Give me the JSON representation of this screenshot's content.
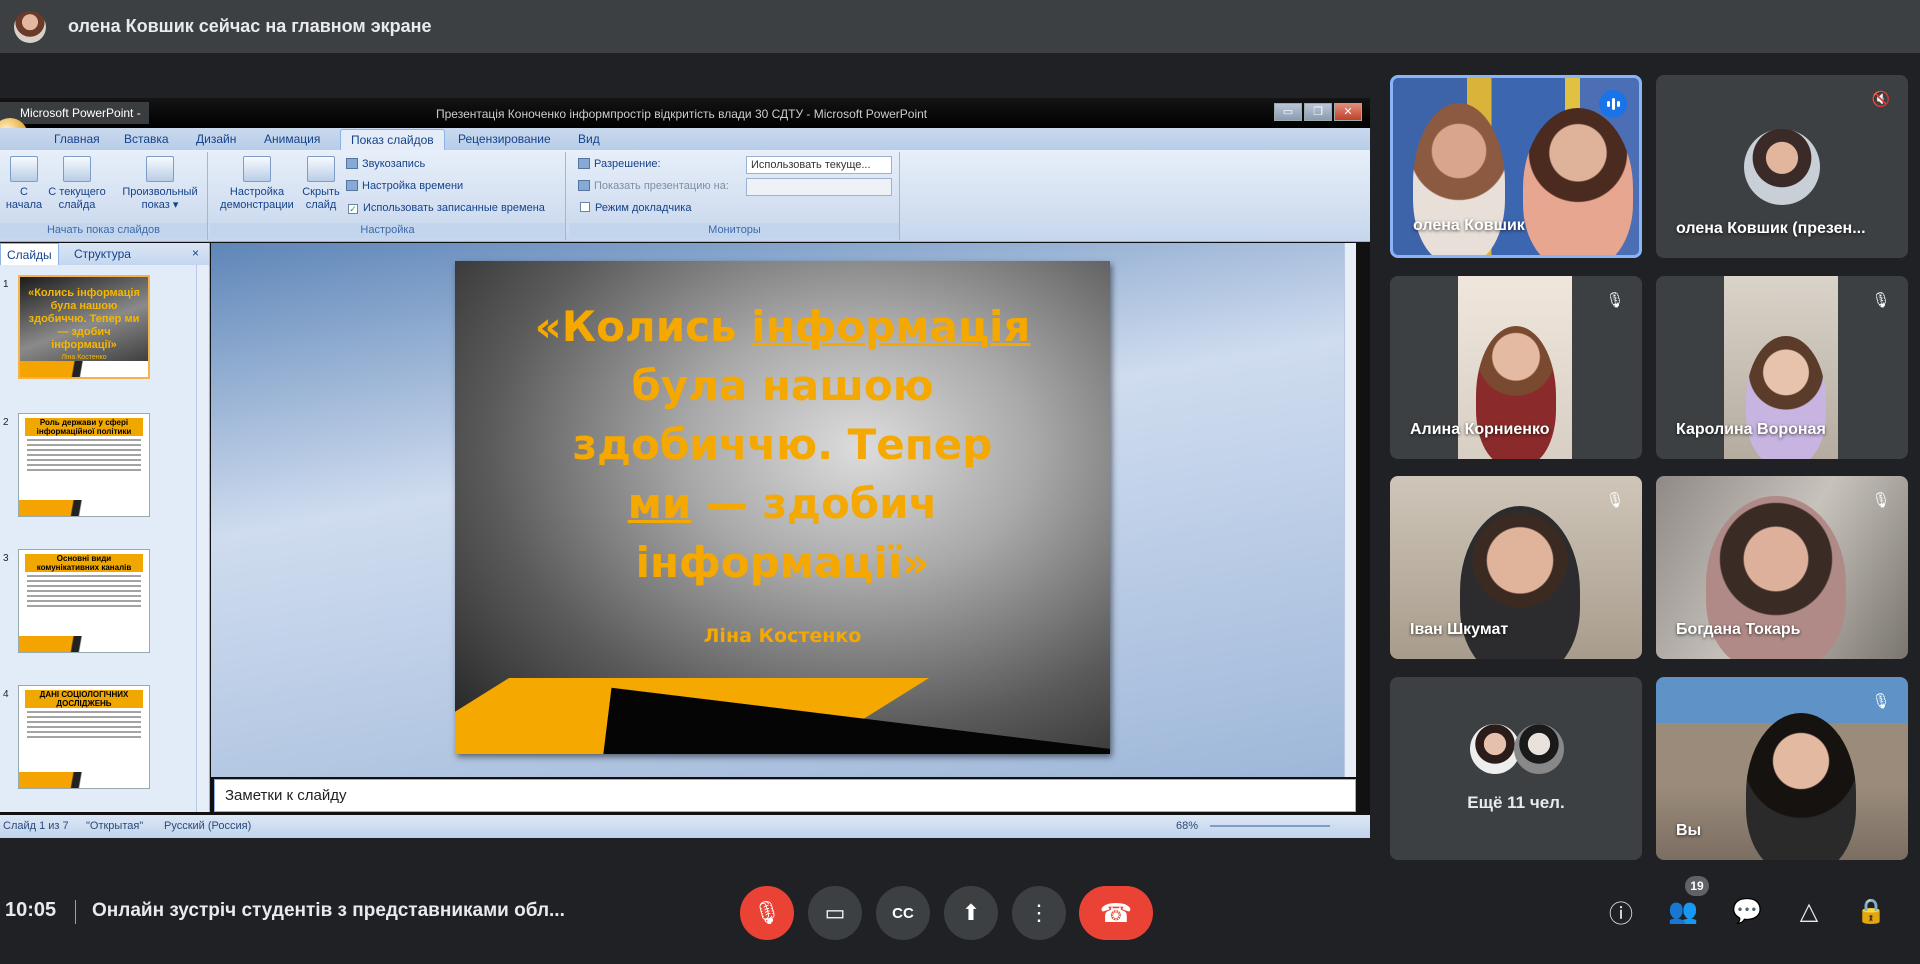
{
  "topbar": {
    "presenter_notice": "олена Ковшик сейчас на главном экране"
  },
  "powerpoint": {
    "app_name": "Microsoft PowerPoint -",
    "doc_title": "Презентація Коноченко інформпростір відкритість влади 30 СДТУ - Microsoft PowerPoint",
    "window_buttons": {
      "minimize": "▭",
      "maximize": "❐",
      "close": "✕"
    },
    "tabs": [
      "Главная",
      "Вставка",
      "Дизайн",
      "Анимация",
      "Показ слайдов",
      "Рецензирование",
      "Вид"
    ],
    "active_tab": "Показ слайдов",
    "ribbon": {
      "group_start": {
        "label": "Начать показ слайдов",
        "from_start_1": "С",
        "from_start_2": "начала",
        "from_current_1": "С текущего",
        "from_current_2": "слайда",
        "custom_1": "Произвольный",
        "custom_2": "показ ▾"
      },
      "group_setup": {
        "label": "Настройка",
        "setup_1": "Настройка",
        "setup_2": "демонстрации",
        "hide_1": "Скрыть",
        "hide_2": "слайд",
        "record": "Звукозапись",
        "timing": "Настройка времени",
        "use_timings": "Использовать записанные времена",
        "check": "✓"
      },
      "group_monitors": {
        "label": "Мониторы",
        "resolution": "Разрешение:",
        "resolution_value": "Использовать текуще...",
        "show_on": "Показать презентацию на:",
        "presenter_view": "Режим докладчика"
      }
    },
    "pane_tabs": {
      "slides": "Слайды",
      "outline": "Структура",
      "close": "×"
    },
    "thumbnails": [
      {
        "num": "1",
        "title": "«Колись інформація була нашою здобиччю. Тепер ми — здобич інформації»",
        "author": "Ліна Костенко"
      },
      {
        "num": "2",
        "title": "Роль держави у сфері інформаційної політики"
      },
      {
        "num": "3",
        "title": "Основні види комунікативних каналів"
      },
      {
        "num": "4",
        "title": "ДАНІ СОЦІОЛОГІЧНИХ ДОСЛІДЖЕНЬ"
      }
    ],
    "slide": {
      "quote_line1_a": "«Колись ",
      "quote_line1_b": "інформація",
      "quote_line2": "була нашою",
      "quote_line3": "здобиччю. Тепер",
      "quote_line4_a": "ми",
      "quote_line4_b": " — здобич",
      "quote_line5": "інформації»",
      "author": "Ліна Костенко"
    },
    "notes_placeholder": "Заметки к слайду",
    "status": {
      "slide_of": "Слайд 1 из 7",
      "theme": "\"Открытая\"",
      "language": "Русский (Россия)",
      "zoom": "68%"
    }
  },
  "participants": [
    {
      "name": "олена Ковшик",
      "state": "speaking"
    },
    {
      "name": "олена Ковшик (презен...",
      "state": "muted"
    },
    {
      "name": "Алина Корниенко",
      "state": "muted"
    },
    {
      "name": "Каролина Вороная",
      "state": "muted"
    },
    {
      "name": "Іван Шкумат",
      "state": "muted"
    },
    {
      "name": "Богдана Токарь",
      "state": "muted"
    },
    {
      "name": "Ещё 11 чел.",
      "state": "more"
    },
    {
      "name": "Вы",
      "state": "muted"
    }
  ],
  "icons": {
    "mic_off": "🎙",
    "mute_sound": "🔇"
  },
  "bottombar": {
    "time": "10:05",
    "meeting_title": "Онлайн зустріч студентів з представниками обл...",
    "participant_count": "19",
    "buttons": {
      "mic": "🎙",
      "camera": "▭",
      "captions": "CC",
      "present": "⬆",
      "more": "⋮",
      "end": "☎"
    },
    "right_icons": {
      "info": "ⓘ",
      "people": "👥",
      "chat": "💬",
      "activities": "△",
      "safety": "🔒"
    }
  },
  "colors": {
    "accent": "#1a73e8",
    "danger": "#ea4335",
    "slide_text": "#f5a800",
    "background": "#202124",
    "tile": "#3c4043"
  }
}
